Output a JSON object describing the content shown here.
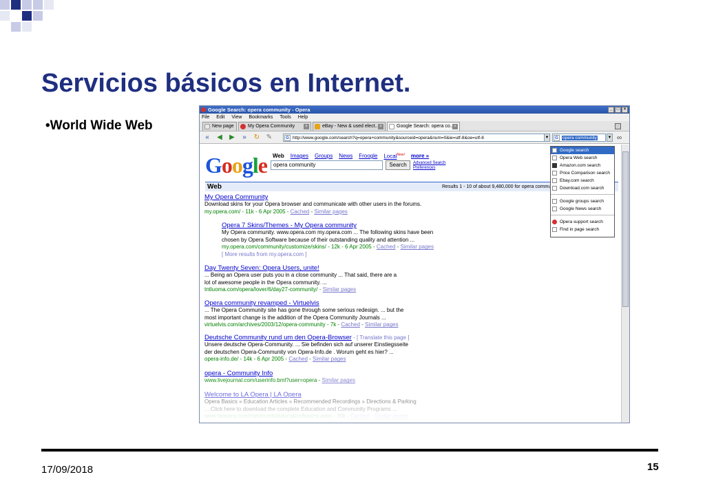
{
  "slide": {
    "title": "Servicios básicos en Internet.",
    "bullet": "•World Wide Web",
    "date": "17/09/2018",
    "page_number": "15"
  },
  "browser": {
    "window_title": "Google Search: opera community - Opera",
    "menu": [
      "File",
      "Edit",
      "View",
      "Bookmarks",
      "Tools",
      "Help"
    ],
    "tabs": [
      {
        "label": "New page"
      },
      {
        "label": "My Opera Community"
      },
      {
        "label": "eBay - New & used elect..."
      },
      {
        "label": "Google Search: opera co..."
      }
    ],
    "address": "http://www.google.com/search?q=opera+community&sourceid=opera&num=0&ie=utf-8&oe=utf-8",
    "search_value": "opera community",
    "search_menu": {
      "group1": [
        "Google search",
        "Opera Web search",
        "Amazon.com search",
        "Price Comparison search",
        "Ebay.com search",
        "Download.com search"
      ],
      "group2": [
        "Google groups search",
        "Google News search"
      ],
      "group3": [
        "Opera support search",
        "Find in page search"
      ]
    }
  },
  "google": {
    "logo": [
      "G",
      "o",
      "o",
      "g",
      "l",
      "e"
    ],
    "logo_colors": [
      "#1a55d9",
      "#d62d20",
      "#e8a317",
      "#1a55d9",
      "#14a33b",
      "#d62d20"
    ],
    "nav": {
      "web": "Web",
      "images": "Images",
      "groups": "Groups",
      "news": "News",
      "froogle": "Froogle",
      "local": "Local",
      "new_badge": "New!",
      "more": "more »"
    },
    "query": "opera community",
    "search_button": "Search",
    "advanced_search": "Advanced Search",
    "preferences": "Preferences",
    "section_label": "Web",
    "results_summary": "Results 1 - 10 of about 9,480,000 for opera community"
  },
  "results": [
    {
      "title": "My Opera Community",
      "lines": [
        "Download skins for your Opera browser and communicate with other users in the forums."
      ],
      "url": "my.opera.com/ - 11k - 6 Apr 2005 -",
      "cached": "Cached",
      "similar": "Similar pages"
    },
    {
      "title": "Opera 7 Skins/Themes - My Opera community",
      "lines": [
        "My Opera community. www.opera.com my.opera.com ... The following skins have been",
        "chosen by Opera Software because of their outstanding quality and attention ..."
      ],
      "url": "my.opera.com/community/customize/skins/ - 12k - 6 Apr 2005 -",
      "cached": "Cached",
      "similar": "Similar pages",
      "more": "[ More results from my.opera.com ]"
    },
    {
      "title": "Day Twenty Seven: Opera Users, unite!",
      "lines": [
        "... Being an Opera user puts you in a close community ... That said, there are a",
        "lot of awesome people in the Opera community. ..."
      ],
      "url": "tntluoma.com/opera/lover/6/day27-community/ -",
      "similar": "Similar pages"
    },
    {
      "title": "Opera community revamped - Virtuelvis",
      "lines": [
        "... The Opera Community site has gone through some serious redesign. ... but the",
        "most important change is the addition of the Opera Community Journals ..."
      ],
      "url": "virtuelvis.com/archives/2003/12/opera-community - 7k -",
      "cached": "Cached",
      "similar": "Similar pages"
    },
    {
      "title": "Deutsche Community rund um den Opera-Browser",
      "title_suffix": " - [ Translate this page ]",
      "lines": [
        "Unsere deutsche Opera-Community. ... Sie befinden sich auf unserer Einstiegsseite",
        "der deutschen Opera-Community von Opera-Info.de . Worum geht es hier? ..."
      ],
      "url": "opera-info.de/ - 14k - 6 Apr 2005 -",
      "cached": "Cached",
      "similar": "Similar pages"
    },
    {
      "title": "opera - Community Info",
      "lines": [],
      "url": "www.livejournal.com/userinfo.bml?user=opera -",
      "similar": "Similar pages"
    },
    {
      "title": "Welcome to LA Opera | LA Opera",
      "lines": [
        "Opera Basics » Education Articles » Recommended Recordings » Directions & Parking",
        "... Click here to download the complete Education and Community Programs ..."
      ],
      "url": "www.laopera.com/community/education/basics.aspx - 30k -",
      "cached": "Cached",
      "similar": "Similar pages"
    }
  ]
}
